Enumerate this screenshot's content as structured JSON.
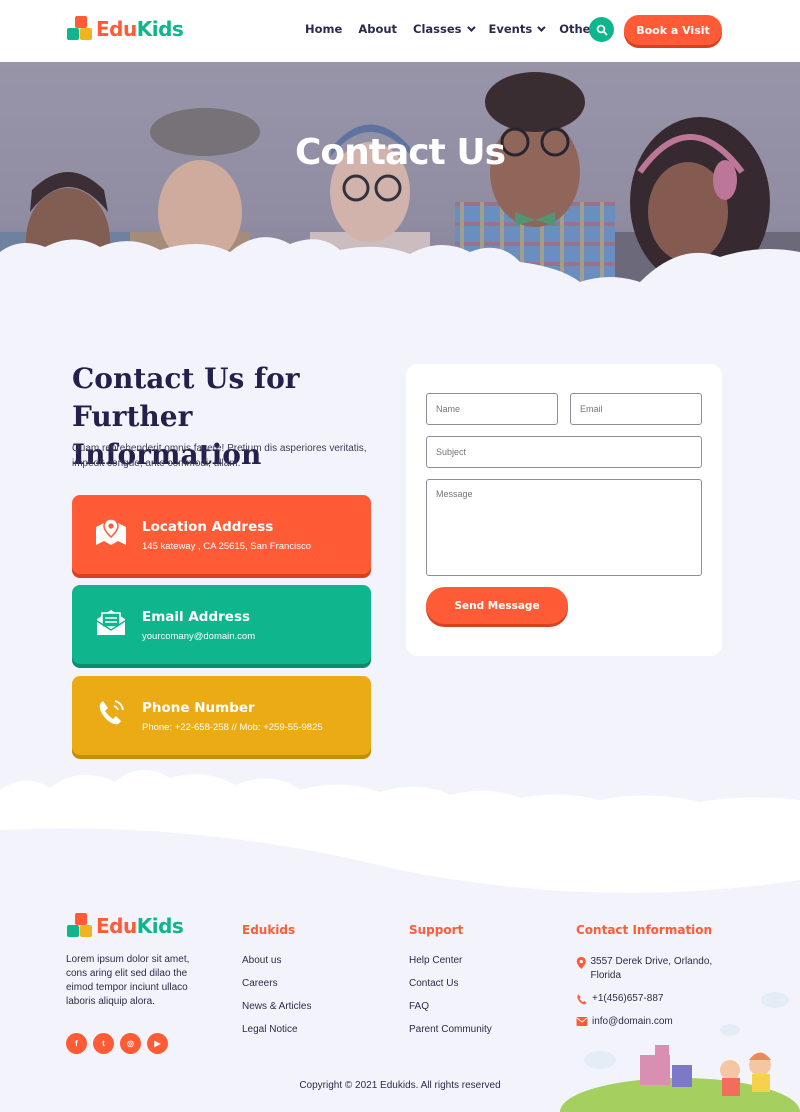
{
  "brand": {
    "edu": "Edu",
    "kids": "Kids",
    "accent": "#ff5b37",
    "secondary": "#0fb68d",
    "tertiary": "#ebab14",
    "dark": "#23204b"
  },
  "nav": {
    "items": [
      {
        "label": "Home",
        "dropdown": false
      },
      {
        "label": "About",
        "dropdown": false
      },
      {
        "label": "Classes",
        "dropdown": true
      },
      {
        "label": "Events",
        "dropdown": true
      },
      {
        "label": "Other",
        "dropdown": true
      }
    ],
    "search_icon": "search-icon",
    "cta": "Book a Visit"
  },
  "hero": {
    "title": "Contact Us"
  },
  "contact": {
    "heading": "Contact Us for Further Information",
    "description": "Quam reprehenderit omnis facere! Pretium dis asperiores veritatis, impedit congue, ante commodi, ullam.",
    "cards": [
      {
        "icon": "map-icon",
        "title": "Location Address",
        "text": "145 kateway , CA 25615, San Francisco"
      },
      {
        "icon": "envelope-icon",
        "title": "Email Address",
        "text": "yourcomany@domain.com"
      },
      {
        "icon": "phone-icon",
        "title": "Phone Number",
        "text": "Phone: +22-658-258 // Mob: +259-55-9825"
      }
    ]
  },
  "form": {
    "name_placeholder": "Name",
    "email_placeholder": "Email",
    "subject_placeholder": "Subject",
    "message_placeholder": "Message",
    "submit": "Send Message"
  },
  "footer": {
    "about": "Lorem ipsum dolor sit amet, cons aring elit sed dilao the eimod tempor inciunt ullaco laboris aliquip alora.",
    "socials": [
      {
        "icon": "facebook-icon",
        "glyph": "f"
      },
      {
        "icon": "twitter-icon",
        "glyph": "t"
      },
      {
        "icon": "instagram-icon",
        "glyph": "◎"
      },
      {
        "icon": "youtube-icon",
        "glyph": "▶"
      }
    ],
    "col1": {
      "title": "Edukids",
      "links": [
        "About us",
        "Careers",
        "News & Articles",
        "Legal Notice"
      ]
    },
    "col2": {
      "title": "Support",
      "links": [
        "Help Center",
        "Contact Us",
        "FAQ",
        "Parent Community"
      ]
    },
    "col3": {
      "title": "Contact Information",
      "address": "3557 Derek Drive, Orlando, Florida",
      "phone": "+1(456)657-887",
      "email": "info@domain.com"
    },
    "copyright": "Copyright © 2021 Edukids. All rights reserved"
  }
}
